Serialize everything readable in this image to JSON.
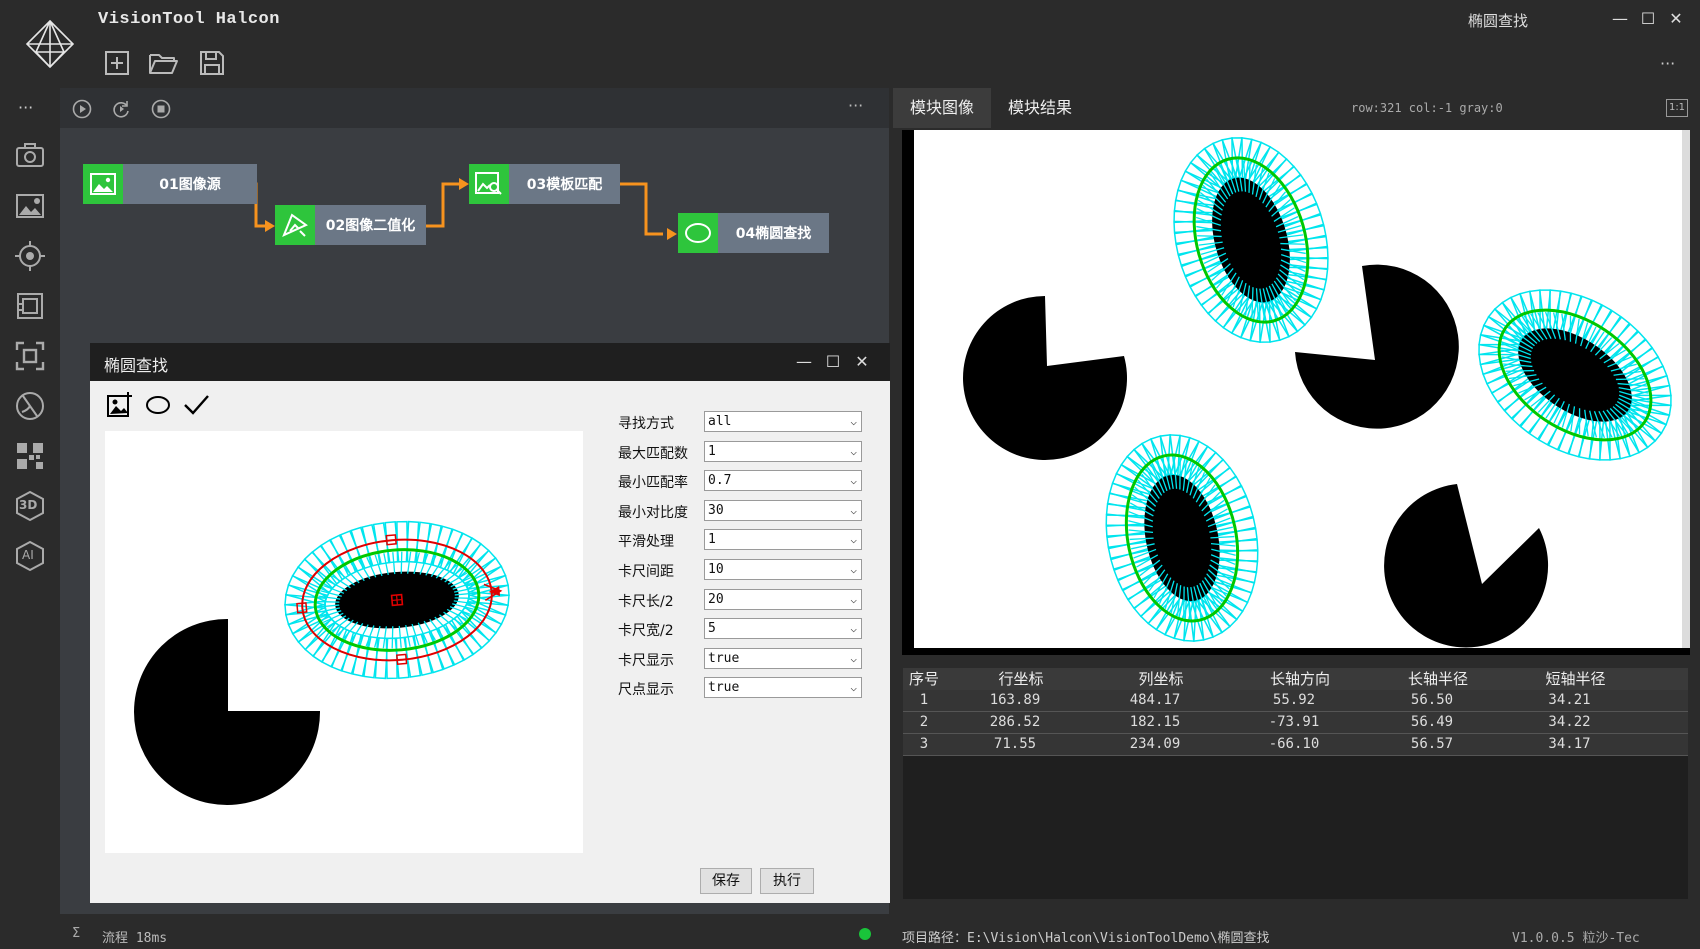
{
  "app": {
    "title": "VisionTool Halcon",
    "window_title": "椭圆查找",
    "minimize": "—",
    "maximize": "☐",
    "close": "✕",
    "more": "···"
  },
  "left_rail": {
    "more": "···",
    "icons": [
      "camera-icon",
      "image-settings-icon",
      "target-icon",
      "layers-icon",
      "focus-frame-icon",
      "measure-icon",
      "qr-code-icon",
      "3d-icon",
      "ai-icon"
    ],
    "d3_label": "3D",
    "ai_label": "AI"
  },
  "flow": {
    "more": "···",
    "nodes": [
      {
        "label": "01图像源"
      },
      {
        "label": "02图像二值化"
      },
      {
        "label": "03模板匹配"
      },
      {
        "label": "04椭圆查找"
      }
    ],
    "node_color": "#2ec53c",
    "connector_color": "#f7931e"
  },
  "dialog": {
    "title": "椭圆查找",
    "params": [
      {
        "label": "寻找方式",
        "value": "all"
      },
      {
        "label": "最大匹配数",
        "value": "1"
      },
      {
        "label": "最小匹配率",
        "value": "0.7"
      },
      {
        "label": "最小对比度",
        "value": "30"
      },
      {
        "label": "平滑处理",
        "value": "1"
      },
      {
        "label": "卡尺间距",
        "value": "10"
      },
      {
        "label": "卡尺长/2",
        "value": "20"
      },
      {
        "label": "卡尺宽/2",
        "value": "5"
      },
      {
        "label": "卡尺显示",
        "value": "true"
      },
      {
        "label": "尺点显示",
        "value": "true"
      }
    ],
    "save_label": "保存",
    "run_label": "执行"
  },
  "right": {
    "tabs": [
      {
        "label": "模块图像"
      },
      {
        "label": "模块结果"
      }
    ],
    "readout": "row:321 col:-1 gray:0",
    "fit_label": "1:1",
    "table": {
      "headers": [
        "序号",
        "行坐标",
        "列坐标",
        "长轴方向",
        "长轴半径",
        "短轴半径"
      ],
      "rows": [
        [
          "1",
          "163.89",
          "484.17",
          "55.92",
          "56.50",
          "34.21"
        ],
        [
          "2",
          "286.52",
          "182.15",
          "-73.91",
          "56.49",
          "34.22"
        ],
        [
          "3",
          "71.55",
          "234.09",
          "-66.10",
          "56.57",
          "34.17"
        ]
      ]
    }
  },
  "status": {
    "sigma": "Σ",
    "flow_time": "流程 18ms",
    "project_path": "项目路径：E:\\Vision\\Halcon\\VisionToolDemo\\椭圆查找",
    "version": "V1.0.0.5 粒沙-Tec",
    "ok_color": "#19c43a"
  },
  "colors": {
    "caliper": "#00e5ee",
    "fit_ellipse": "#00c800",
    "roi": "#e00000"
  }
}
